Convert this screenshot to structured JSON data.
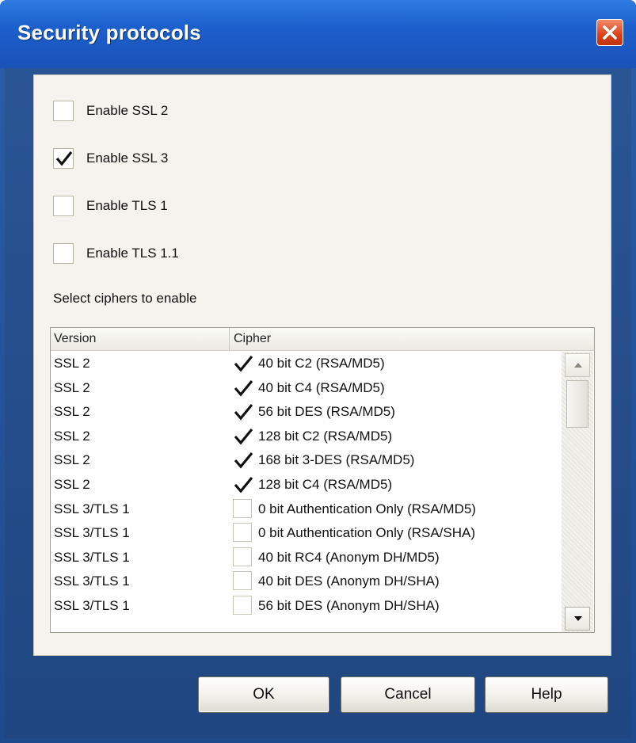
{
  "window": {
    "title": "Security protocols"
  },
  "protocols": [
    {
      "label": "Enable SSL 2",
      "checked": false
    },
    {
      "label": "Enable SSL 3",
      "checked": true
    },
    {
      "label": "Enable TLS 1",
      "checked": false
    },
    {
      "label": "Enable TLS 1.1",
      "checked": false
    }
  ],
  "ciphers_label": "Select ciphers to enable",
  "list": {
    "columns": {
      "version": "Version",
      "cipher": "Cipher"
    },
    "rows": [
      {
        "version": "SSL 2",
        "cipher": "40 bit C2 (RSA/MD5)",
        "checked": true
      },
      {
        "version": "SSL 2",
        "cipher": "40 bit C4 (RSA/MD5)",
        "checked": true
      },
      {
        "version": "SSL 2",
        "cipher": "56 bit DES (RSA/MD5)",
        "checked": true
      },
      {
        "version": "SSL 2",
        "cipher": "128 bit C2 (RSA/MD5)",
        "checked": true
      },
      {
        "version": "SSL 2",
        "cipher": "168 bit 3-DES (RSA/MD5)",
        "checked": true
      },
      {
        "version": "SSL 2",
        "cipher": "128 bit C4 (RSA/MD5)",
        "checked": true
      },
      {
        "version": "SSL 3/TLS 1",
        "cipher": "0 bit Authentication Only (RSA/MD5)",
        "checked": false
      },
      {
        "version": "SSL 3/TLS 1",
        "cipher": "0 bit Authentication Only (RSA/SHA)",
        "checked": false
      },
      {
        "version": "SSL 3/TLS 1",
        "cipher": "40 bit RC4 (Anonym DH/MD5)",
        "checked": false
      },
      {
        "version": "SSL 3/TLS 1",
        "cipher": "40 bit DES (Anonym DH/SHA)",
        "checked": false
      },
      {
        "version": "SSL 3/TLS 1",
        "cipher": "56 bit DES (Anonym DH/SHA)",
        "checked": false
      }
    ]
  },
  "buttons": {
    "ok": "OK",
    "cancel": "Cancel",
    "help": "Help"
  }
}
